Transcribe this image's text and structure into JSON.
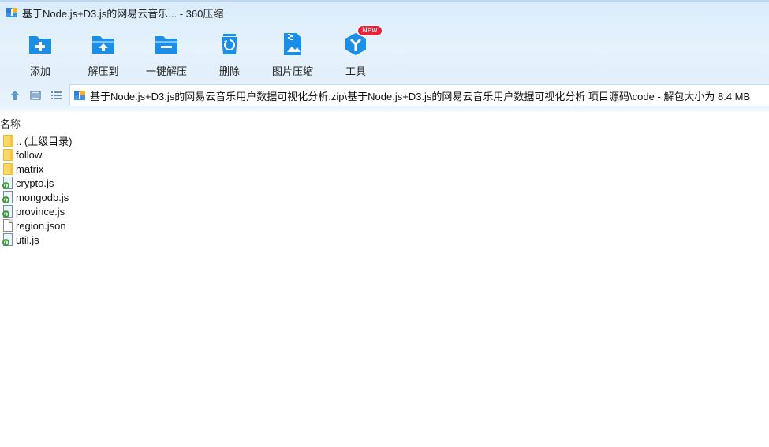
{
  "window": {
    "title": "基于Node.js+D3.js的网易云音乐...  - 360压缩"
  },
  "toolbar": {
    "items": [
      {
        "label": "添加",
        "icon": "add-plus-icon"
      },
      {
        "label": "解压到",
        "icon": "extract-to-icon"
      },
      {
        "label": "一键解压",
        "icon": "one-click-extract-icon"
      },
      {
        "label": "删除",
        "icon": "recycle-bin-icon"
      },
      {
        "label": "图片压缩",
        "icon": "image-compress-icon"
      },
      {
        "label": "工具",
        "icon": "tools-cube-icon"
      }
    ],
    "new_badge": "New"
  },
  "nav": {
    "path": "基于Node.js+D3.js的网易云音乐用户数据可视化分析.zip\\基于Node.js+D3.js的网易云音乐用户数据可视化分析 项目源码\\code - 解包大小为 8.4 MB"
  },
  "list": {
    "column_name": "名称",
    "items": [
      {
        "name": ".. (上级目录)",
        "type": "folder"
      },
      {
        "name": "follow",
        "type": "folder"
      },
      {
        "name": "matrix",
        "type": "folder"
      },
      {
        "name": "crypto.js",
        "type": "js"
      },
      {
        "name": "mongodb.js",
        "type": "js"
      },
      {
        "name": "province.js",
        "type": "js"
      },
      {
        "name": "region.json",
        "type": "doc"
      },
      {
        "name": "util.js",
        "type": "js"
      }
    ]
  },
  "colors": {
    "accent": "#1b8ee8",
    "badge": "#e8233b",
    "folder": "#ffd966"
  }
}
